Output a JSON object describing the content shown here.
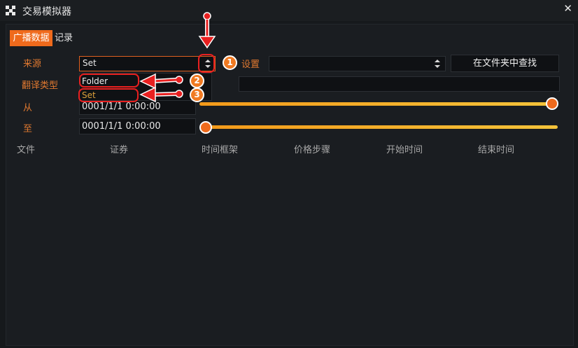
{
  "window": {
    "title": "交易模拟器",
    "close_glyph": "✕"
  },
  "tabs": [
    {
      "label": "广播数据",
      "active": true
    },
    {
      "label": "记录",
      "active": false
    }
  ],
  "form": {
    "source_label": "来源",
    "source_value": "Set",
    "source_options": [
      "Folder",
      "Set"
    ],
    "translation_type_label": "翻译类型",
    "from_label": "从",
    "from_value": "0001/1/1 0:00:00",
    "to_label": "至",
    "to_value": "0001/1/1 0:00:00",
    "settings_label": "设置",
    "settings_value": "",
    "find_in_folder_button": "在文件夹中查找",
    "path_value": ""
  },
  "sliders": {
    "from_position": 1.0,
    "to_position": 0.0
  },
  "table": {
    "columns": [
      "文件",
      "证券",
      "时间框架",
      "价格步骤",
      "开始时间",
      "结束时间"
    ],
    "rows": []
  },
  "annotations": {
    "badges": [
      "1",
      "2",
      "3"
    ]
  },
  "colors": {
    "accent": "#ef6a1c",
    "label_orange": "#e07930",
    "slider_gradient_start": "#f39a1a",
    "slider_gradient_end": "#f4c33a",
    "annotation_red": "#e82020",
    "background": "#16191c"
  },
  "icons": {
    "app": "app-grid-icon",
    "close": "close-icon",
    "spinner": "spin-arrows-icon"
  }
}
